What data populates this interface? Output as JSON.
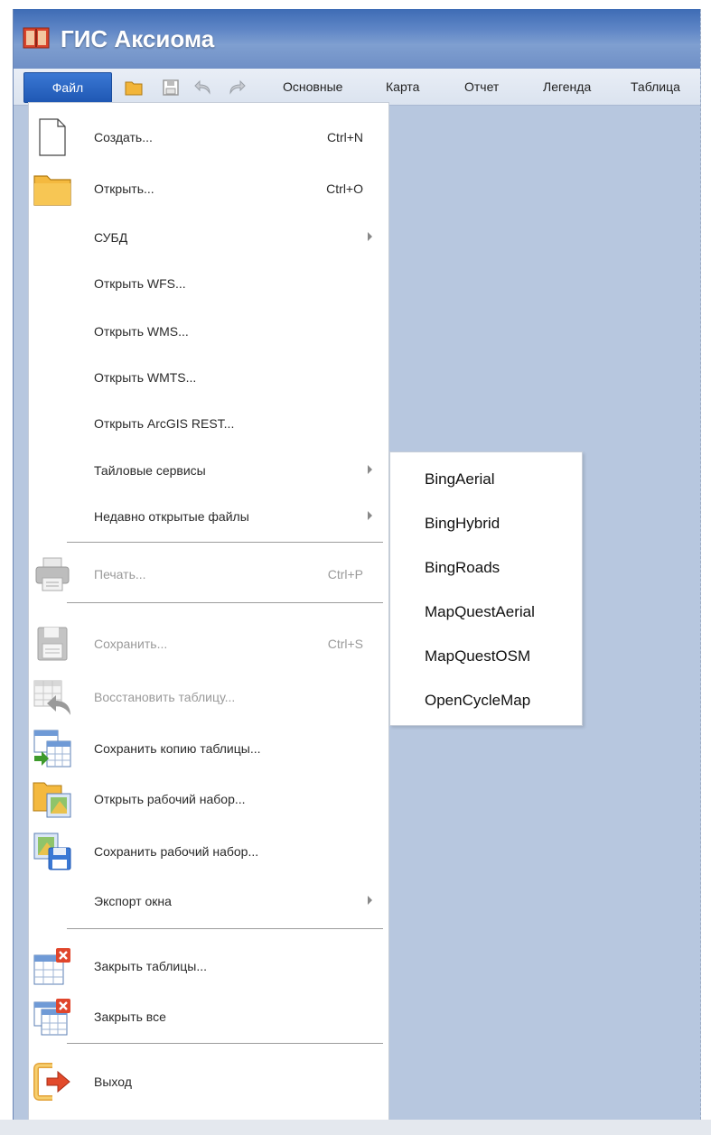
{
  "window": {
    "title": "ГИС Аксиома",
    "colors": {
      "title_bar": "#4f7ec2",
      "map_bg": "#b7c7df",
      "file_tab": "#2a66c4"
    }
  },
  "ribbon": {
    "file_tab": "Файл",
    "quick_access": [
      "open-folder-icon",
      "save-icon",
      "undo-icon",
      "redo-icon"
    ],
    "tabs": [
      "Основные",
      "Карта",
      "Отчет",
      "Легенда",
      "Таблица"
    ]
  },
  "file_menu": {
    "items": [
      {
        "label": "Создать...",
        "shortcut": "Ctrl+N",
        "icon": "new-document-icon"
      },
      {
        "label": "Открыть...",
        "shortcut": "Ctrl+O",
        "icon": "open-folder-icon"
      },
      {
        "label": "СУБД",
        "submenu": true
      },
      {
        "label": "Открыть WFS..."
      },
      {
        "label": "Открыть WMS..."
      },
      {
        "label": "Открыть WMTS..."
      },
      {
        "label": "Открыть ArcGIS REST..."
      },
      {
        "label": "Тайловые сервисы",
        "submenu": true
      },
      {
        "label": "Недавно открытые файлы",
        "submenu": true
      },
      {
        "label": "Печать...",
        "shortcut": "Ctrl+P",
        "icon": "printer-icon",
        "disabled": true
      },
      {
        "label": "Сохранить...",
        "shortcut": "Ctrl+S",
        "icon": "save-icon",
        "disabled": true
      },
      {
        "label": "Восстановить таблицу...",
        "icon": "restore-table-icon",
        "disabled": true
      },
      {
        "label": "Сохранить копию таблицы...",
        "icon": "save-table-copy-icon"
      },
      {
        "label": "Открыть рабочий набор...",
        "icon": "open-workspace-icon"
      },
      {
        "label": "Сохранить рабочий набор...",
        "icon": "save-workspace-icon"
      },
      {
        "label": "Экспорт окна",
        "submenu": true
      },
      {
        "label": "Закрыть таблицы...",
        "icon": "close-tables-icon"
      },
      {
        "label": "Закрыть все",
        "icon": "close-all-icon"
      },
      {
        "label": "Выход",
        "icon": "exit-icon"
      }
    ]
  },
  "tile_services_submenu": {
    "items": [
      "BingAerial",
      "BingHybrid",
      "BingRoads",
      "MapQuestAerial",
      "MapQuestOSM",
      "OpenCycleMap"
    ]
  }
}
